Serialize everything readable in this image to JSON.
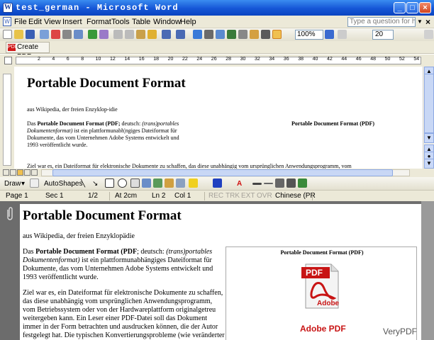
{
  "window": {
    "title": "test_german - Microsoft Word",
    "app_icon": "W"
  },
  "menu": {
    "items": [
      "File",
      "Edit",
      "View",
      "Insert",
      "Format",
      "Tools",
      "Table",
      "Window",
      "Help"
    ],
    "ask_placeholder": "Type a question for help",
    "close": "×"
  },
  "toolbar": {
    "zoom": "100%",
    "font_size": "20"
  },
  "pdf_toolbar": {
    "create_pdf": "Create PDF",
    "pdf_icon": "PDF"
  },
  "ruler": {
    "ticks": [
      "2",
      "4",
      "6",
      "8",
      "10",
      "12",
      "14",
      "16",
      "18",
      "20",
      "22",
      "24",
      "26",
      "28",
      "30",
      "32",
      "34",
      "36",
      "38",
      "40",
      "42",
      "44",
      "46",
      "48",
      "50",
      "52",
      "54"
    ]
  },
  "word_doc": {
    "heading": "Portable Document Format",
    "line1": "aus Wikipedia, der freien Enzyklop-idie",
    "para1_a": "Das ",
    "para1_b": "Portable Document Format (PDF;",
    "para1_c": " deutsch: ",
    "para1_d": "(trans)portables",
    "para1_e": "Dokumentenformat)",
    "para1_f": " ist ein plattformunabh¦ngiges Dateiformat für",
    "para1_g": "Dokumente, das vom Unternehmen Adobe Systems entwickelt und",
    "para1_h": "1993 veröffentlicht wurde.",
    "sidebar_title": "Portable Document Format (PDF)",
    "para2": "Ziel war es, ein Dateiformat für elektronische Dokumente zu schaffen, das diese unabhängig vom ursprünglichen Anwendungsprogramm, vom"
  },
  "draw_toolbar": {
    "draw": "Draw",
    "autoshapes": "AutoShapes"
  },
  "status": {
    "page": "Page 1",
    "sec": "Sec 1",
    "pages": "1/2",
    "at": "At 2cm",
    "ln": "Ln 2",
    "col": "Col 1",
    "rec": "REC",
    "trk": "TRK",
    "ext": "EXT",
    "ovr": "OVR",
    "lang": "Chinese (PR"
  },
  "pdf_view": {
    "heading": "Portable Document Format",
    "line1": "aus Wikipedia, der freien Enzyklopädie",
    "p1": [
      "Das ",
      "Portable Document Format (PDF",
      ";  deutsch: ",
      "(trans)portables"
    ],
    "p2": [
      "Dokumentenformat)",
      " ist ein plattformunabhängiges Dateiformat für"
    ],
    "p3": "Dokumente, das vom Unternehmen Adobe Systems entwickelt und",
    "p4": "1993 veröffentlicht wurde.",
    "q1": "Ziel war es, ein Dateiformat für elektronische Dokumente zu schaffen,",
    "q2": "das diese unabhängig vom ursprünglichen Anwendungsprogramm,",
    "q3": "vom Betriebssystem oder von der Hardwareplattform originalgetreu",
    "q4": "weitergeben kann. Ein Leser einer PDF-Datei soll das Dokument",
    "q5": "immer in der Form betrachten und ausdrucken können, die der Autor",
    "q6": "festgelegt hat. Die typischen Konvertierungsprobleme (wie veränderter",
    "infobox_title": "Portable Document Format (PDF)",
    "pdf_label": "PDF",
    "adobe_label": "Adobe",
    "adobe_pdf": "Adobe PDF"
  },
  "watermark": "VeryPDF"
}
